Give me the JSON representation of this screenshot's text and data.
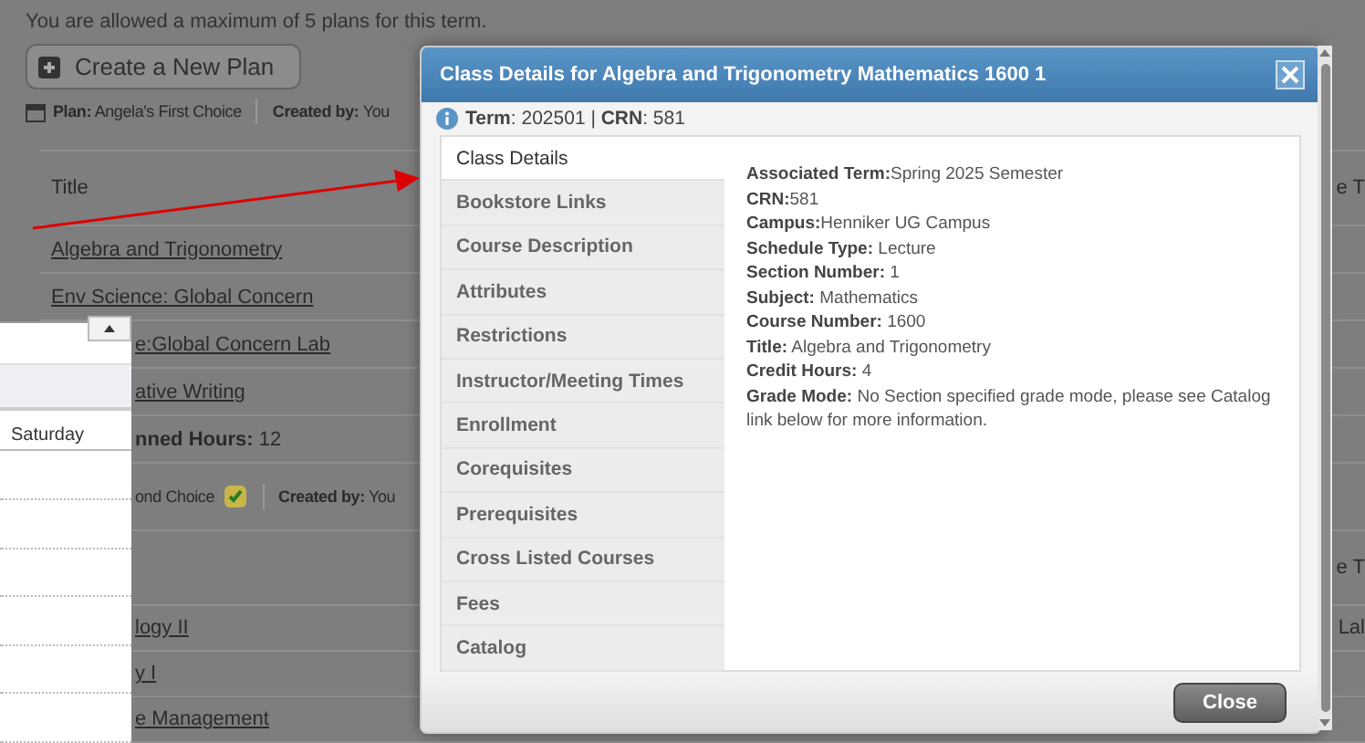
{
  "page": {
    "notice": "You are allowed a maximum of 5 plans for this term.",
    "create_button": "Create a New Plan",
    "plan": {
      "label": "Plan:",
      "name": "Angela's First Choice",
      "created_label": "Created by:",
      "created_value": "You"
    },
    "table": {
      "header": "Title",
      "header_cut": "e T",
      "rows": [
        {
          "text": "Algebra and Trigonometry"
        },
        {
          "text": "Env Science: Global Concern"
        }
      ],
      "covered_rows": [
        {
          "text": "e:Global Concern Lab"
        },
        {
          "text": "ative Writing"
        }
      ]
    },
    "planned_hours": "**nned Hours:** 12",
    "second_plan": {
      "name": "ond Choice",
      "created_label": "Created by:",
      "created_value": "You"
    },
    "second_table": {
      "header_cut": "e T",
      "rows": [
        {
          "text": "logy II",
          "cut": "Lal"
        },
        {
          "text": "y I"
        },
        {
          "text": "e Management"
        }
      ]
    }
  },
  "calendar": {
    "column": "Saturday"
  },
  "dialog": {
    "title": "Class Details for Algebra and Trigonometry Mathematics 1600 1",
    "info": "**Term**: 202501 | **CRN**: 581",
    "tabs": [
      {
        "label": "Class Details",
        "selected": true
      },
      {
        "label": "Bookstore Links",
        "selected": false
      },
      {
        "label": "Course Description",
        "selected": false
      },
      {
        "label": "Attributes",
        "selected": false
      },
      {
        "label": "Restrictions",
        "selected": false
      },
      {
        "label": "Instructor/Meeting Times",
        "selected": false
      },
      {
        "label": "Enrollment",
        "selected": false
      },
      {
        "label": "Corequisites",
        "selected": false
      },
      {
        "label": "Prerequisites",
        "selected": false
      },
      {
        "label": "Cross Listed Courses",
        "selected": false
      },
      {
        "label": "Fees",
        "selected": false
      },
      {
        "label": "Catalog",
        "selected": false
      }
    ],
    "details": [
      "**Associated Term:**Spring 2025 Semester",
      "**CRN:**581",
      "**Campus:**Henniker UG Campus",
      "**Schedule Type:** Lecture",
      "**Section Number:** 1",
      "**Subject:** Mathematics",
      "**Course Number:** 1600",
      "**Title:** Algebra and Trigonometry",
      "**Credit Hours:** 4",
      "**Grade Mode:** No Section specified grade mode, please see Catalog link below for more information."
    ],
    "close_button": "Close"
  }
}
